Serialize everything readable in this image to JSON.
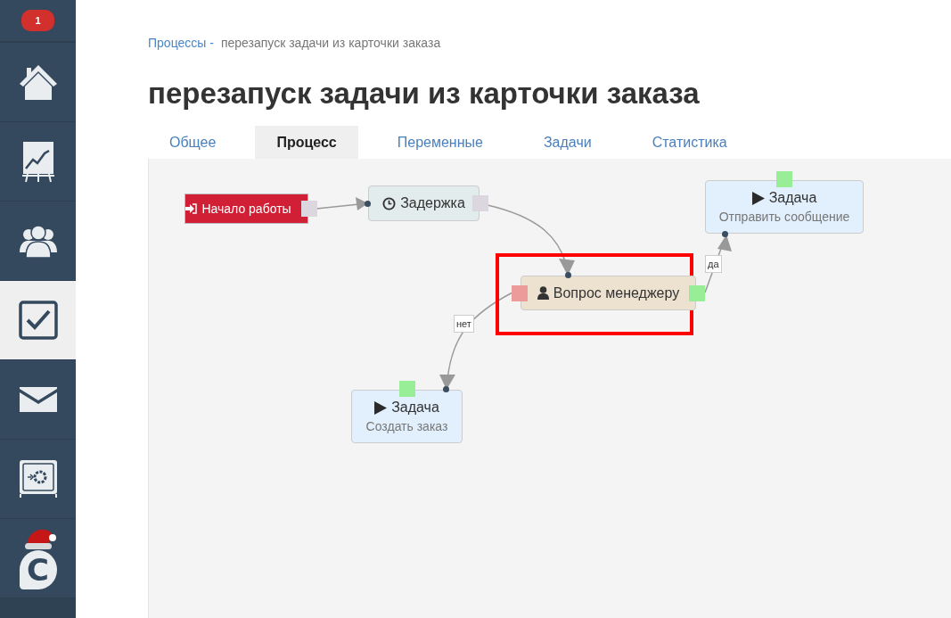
{
  "sidebar": {
    "badge": "1",
    "items": [
      {
        "kind": "home",
        "selected": false
      },
      {
        "kind": "chart",
        "selected": false
      },
      {
        "kind": "people",
        "selected": false
      },
      {
        "kind": "tasks",
        "selected": true
      },
      {
        "kind": "mail",
        "selected": false
      },
      {
        "kind": "safe",
        "selected": false
      },
      {
        "kind": "logo",
        "selected": false
      }
    ],
    "logo_letter": "C"
  },
  "breadcrumb": {
    "link": "Процессы -",
    "current": "перезапуск задачи из карточки заказа"
  },
  "title": "перезапуск задачи из карточки заказа",
  "tabs": [
    {
      "label": "Общее",
      "selected": false
    },
    {
      "label": "Процесс",
      "selected": true
    },
    {
      "label": "Переменные",
      "selected": false
    },
    {
      "label": "Задачи",
      "selected": false
    },
    {
      "label": "Статистика",
      "selected": false
    }
  ],
  "diagram": {
    "nodes": [
      {
        "kind": "start",
        "title": "Начало работы",
        "highlighted": false
      },
      {
        "kind": "delay",
        "title": "Задержка",
        "highlighted": false
      },
      {
        "kind": "task",
        "title": "Задача",
        "subtitle": "Отправить сообщение",
        "highlighted": false
      },
      {
        "kind": "question",
        "title": "Вопрос менеджеру",
        "highlighted": true
      },
      {
        "kind": "task",
        "title": "Задача",
        "subtitle": "Создать заказ",
        "highlighted": false
      }
    ],
    "edge_labels": [
      "да",
      "нет"
    ]
  }
}
